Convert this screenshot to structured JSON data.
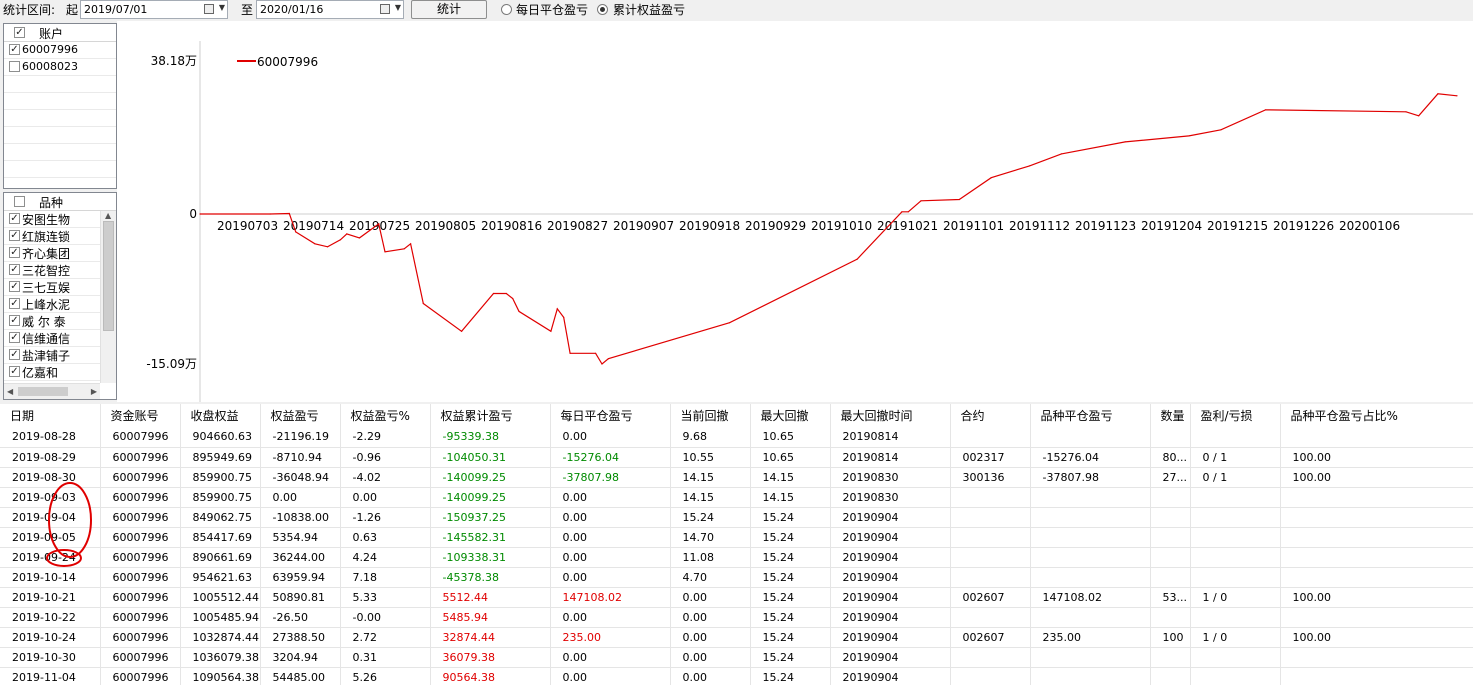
{
  "toolbar": {
    "range_label": "统计区间:",
    "from_label": "起",
    "from_date": "2019/07/01",
    "to_label": "至",
    "to_date": "2020/01/16",
    "stat_button": "统计",
    "radio_daily": "每日平仓盈亏",
    "radio_cumulative": "累计权益盈亏",
    "selected_radio": "cumulative"
  },
  "accounts": {
    "header": "账户",
    "items": [
      {
        "label": "60007996",
        "checked": true
      },
      {
        "label": "60008023",
        "checked": false
      }
    ]
  },
  "varieties": {
    "header": "品种",
    "items": [
      {
        "label": "安图生物",
        "checked": true
      },
      {
        "label": "红旗连锁",
        "checked": true
      },
      {
        "label": "齐心集团",
        "checked": true
      },
      {
        "label": "三花智控",
        "checked": true
      },
      {
        "label": "三七互娱",
        "checked": true
      },
      {
        "label": "上峰水泥",
        "checked": true
      },
      {
        "label": "威 尔 泰",
        "checked": true
      },
      {
        "label": "信维通信",
        "checked": true
      },
      {
        "label": "盐津铺子",
        "checked": true
      },
      {
        "label": "亿嘉和",
        "checked": true
      }
    ]
  },
  "chart_data": {
    "type": "line",
    "title": "",
    "y_tick_labels": [
      "38.18万",
      "0",
      "-15.09万"
    ],
    "y_tick_values": [
      381800,
      0,
      -150900
    ],
    "ylim": [
      -150900,
      381800
    ],
    "x_tick_labels": [
      "20190703",
      "20190714",
      "20190725",
      "20190805",
      "20190816",
      "20190827",
      "20190907",
      "20190918",
      "20190929",
      "20191010",
      "20191021",
      "20191101",
      "20191112",
      "20191123",
      "20191204",
      "20191215",
      "20191226",
      "20200106"
    ],
    "legend_position": "top-left",
    "series": [
      {
        "name": "60007996",
        "color": "#e00000",
        "x": [
          "20190703",
          "20190714",
          "20190717",
          "20190718",
          "20190721",
          "20190723",
          "20190725",
          "20190726",
          "20190728",
          "20190731",
          "20190801",
          "20190804",
          "20190805",
          "20190807",
          "20190813",
          "20190818",
          "20190820",
          "20190821",
          "20190822",
          "20190827",
          "20190828",
          "20190829",
          "20190830",
          "20190903",
          "20190904",
          "20190905",
          "20190924",
          "20191014",
          "20191021",
          "20191022",
          "20191024",
          "20191030",
          "20191104",
          "20191110",
          "20191115",
          "20191125",
          "20191205",
          "20191210",
          "20191217",
          "20200108",
          "20200110",
          "20200113",
          "20200116"
        ],
        "y": [
          0,
          0,
          1200,
          -18000,
          -30000,
          -33000,
          -26000,
          -20000,
          -24000,
          -10000,
          -38000,
          -35000,
          -30000,
          -90000,
          -118000,
          -80000,
          -80000,
          -85000,
          -98000,
          -118000,
          -95339.38,
          -104050.31,
          -140099.25,
          -140099.25,
          -150937.25,
          -145582.31,
          -109338.31,
          -45378.38,
          5512.44,
          5485.94,
          32874.44,
          36079.38,
          90564.38,
          120000,
          150000,
          180000,
          195000,
          210000,
          260000,
          255000,
          245000,
          300000,
          295000
        ]
      }
    ]
  },
  "table": {
    "columns": [
      "日期",
      "资金账号",
      "收盘权益",
      "权益盈亏",
      "权益盈亏%",
      "权益累计盈亏",
      "每日平仓盈亏",
      "当前回撤",
      "最大回撤",
      "最大回撤时间",
      "合约",
      "品种平仓盈亏",
      "数量",
      "盈利/亏损",
      "品种平仓盈亏占比%"
    ],
    "rows": [
      [
        "2019-08-28",
        "60007996",
        "904660.63",
        "-21196.19",
        "-2.29",
        "-95339.38",
        "0.00",
        "9.68",
        "10.65",
        "20190814",
        "",
        "",
        "",
        "",
        ""
      ],
      [
        "2019-08-29",
        "60007996",
        "895949.69",
        "-8710.94",
        "-0.96",
        "-104050.31",
        "-15276.04",
        "10.55",
        "10.65",
        "20190814",
        "002317",
        "-15276.04",
        "80...",
        "0 / 1",
        "100.00"
      ],
      [
        "2019-08-30",
        "60007996",
        "859900.75",
        "-36048.94",
        "-4.02",
        "-140099.25",
        "-37807.98",
        "14.15",
        "14.15",
        "20190830",
        "300136",
        "-37807.98",
        "27...",
        "0 / 1",
        "100.00"
      ],
      [
        "2019-09-03",
        "60007996",
        "859900.75",
        "0.00",
        "0.00",
        "-140099.25",
        "0.00",
        "14.15",
        "14.15",
        "20190830",
        "",
        "",
        "",
        "",
        ""
      ],
      [
        "2019-09-04",
        "60007996",
        "849062.75",
        "-10838.00",
        "-1.26",
        "-150937.25",
        "0.00",
        "15.24",
        "15.24",
        "20190904",
        "",
        "",
        "",
        "",
        ""
      ],
      [
        "2019-09-05",
        "60007996",
        "854417.69",
        "5354.94",
        "0.63",
        "-145582.31",
        "0.00",
        "14.70",
        "15.24",
        "20190904",
        "",
        "",
        "",
        "",
        ""
      ],
      [
        "2019-09-24",
        "60007996",
        "890661.69",
        "36244.00",
        "4.24",
        "-109338.31",
        "0.00",
        "11.08",
        "15.24",
        "20190904",
        "",
        "",
        "",
        "",
        ""
      ],
      [
        "2019-10-14",
        "60007996",
        "954621.63",
        "63959.94",
        "7.18",
        "-45378.38",
        "0.00",
        "4.70",
        "15.24",
        "20190904",
        "",
        "",
        "",
        "",
        ""
      ],
      [
        "2019-10-21",
        "60007996",
        "1005512.44",
        "50890.81",
        "5.33",
        "5512.44",
        "147108.02",
        "0.00",
        "15.24",
        "20190904",
        "002607",
        "147108.02",
        "53...",
        "1 / 0",
        "100.00"
      ],
      [
        "2019-10-22",
        "60007996",
        "1005485.94",
        "-26.50",
        "-0.00",
        "5485.94",
        "0.00",
        "0.00",
        "15.24",
        "20190904",
        "",
        "",
        "",
        "",
        ""
      ],
      [
        "2019-10-24",
        "60007996",
        "1032874.44",
        "27388.50",
        "2.72",
        "32874.44",
        "235.00",
        "0.00",
        "15.24",
        "20190904",
        "002607",
        "235.00",
        "100",
        "1 / 0",
        "100.00"
      ],
      [
        "2019-10-30",
        "60007996",
        "1036079.38",
        "3204.94",
        "0.31",
        "36079.38",
        "0.00",
        "0.00",
        "15.24",
        "20190904",
        "",
        "",
        "",
        "",
        ""
      ],
      [
        "2019-11-04",
        "60007996",
        "1090564.38",
        "54485.00",
        "5.26",
        "90564.38",
        "0.00",
        "0.00",
        "15.24",
        "20190904",
        "",
        "",
        "",
        "",
        ""
      ]
    ]
  }
}
